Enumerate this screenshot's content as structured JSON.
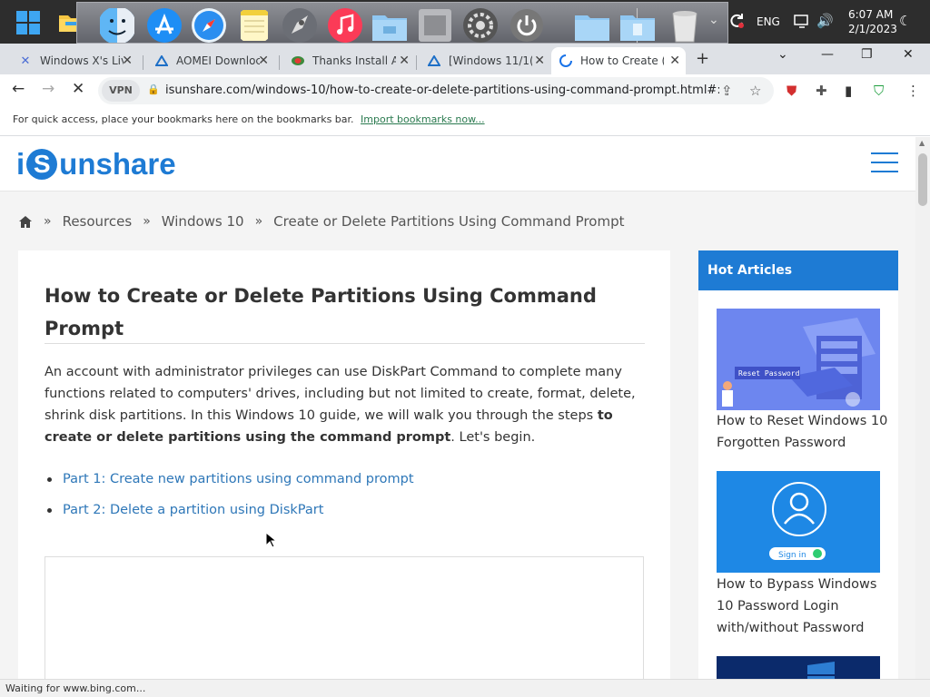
{
  "taskbar": {
    "clock_time": "6:07 AM",
    "clock_date": "2/1/2023",
    "language": "ENG",
    "dock_icons": [
      "finder-icon",
      "app-store-icon",
      "safari-icon",
      "notes-icon",
      "launchpad-icon",
      "music-icon",
      "folder-icon",
      "system-icon",
      "settings-icon",
      "power-icon",
      "folder-icon",
      "folder-icon",
      "trash-icon"
    ]
  },
  "browser": {
    "tabs": [
      {
        "label": "Windows X's Liv",
        "favicon": "windows-x-icon"
      },
      {
        "label": "AOMEI Downloc",
        "favicon": "aomei-icon"
      },
      {
        "label": "Thanks Install A",
        "favicon": "easeus-icon"
      },
      {
        "label": "[Windows 11/1(",
        "favicon": "aomei-icon"
      },
      {
        "label": "How to Create (",
        "favicon": "loading-icon",
        "active": true
      }
    ],
    "vpn_label": "VPN",
    "url": "isunshare.com/windows-10/how-to-create-or-delete-partitions-using-command-prompt.html#:...",
    "bookmarks_hint": "For quick access, place your bookmarks here on the bookmarks bar.",
    "bookmarks_link": "Import bookmarks now...",
    "status_text": "Waiting for www.bing.com..."
  },
  "site": {
    "logo_pre": "i",
    "logo_s": "S",
    "logo_post": "unshare",
    "breadcrumbs": [
      "Resources",
      "Windows 10",
      "Create or Delete Partitions Using Command Prompt"
    ]
  },
  "article": {
    "title": "How to Create or Delete Partitions Using Command Prompt",
    "intro_normal": "An account with administrator privileges can use DiskPart Command to complete many functions related to computers' drives, including but not limited to create, format, delete, shrink disk partitions. In this Windows 10 guide, we will walk you through the steps ",
    "intro_bold": "to create or delete partitions using the command prompt",
    "intro_end": ". Let's begin.",
    "toc": [
      "Part 1: Create new partitions using command prompt",
      "Part 2: Delete a partition using DiskPart"
    ]
  },
  "sidebar": {
    "heading": "Hot Articles",
    "thumb1_caption": "Reset Password",
    "thumb2_caption": "Sign in",
    "articles": [
      "How to Reset Windows 10 Forgotten Password",
      "How to Bypass Windows 10 Password Login with/without Password"
    ]
  },
  "colors": {
    "brand_blue": "#1e7bd4",
    "link_blue": "#2e77b8",
    "taskbar": "#2d2d2d",
    "tabstrip": "#dee1e6"
  }
}
